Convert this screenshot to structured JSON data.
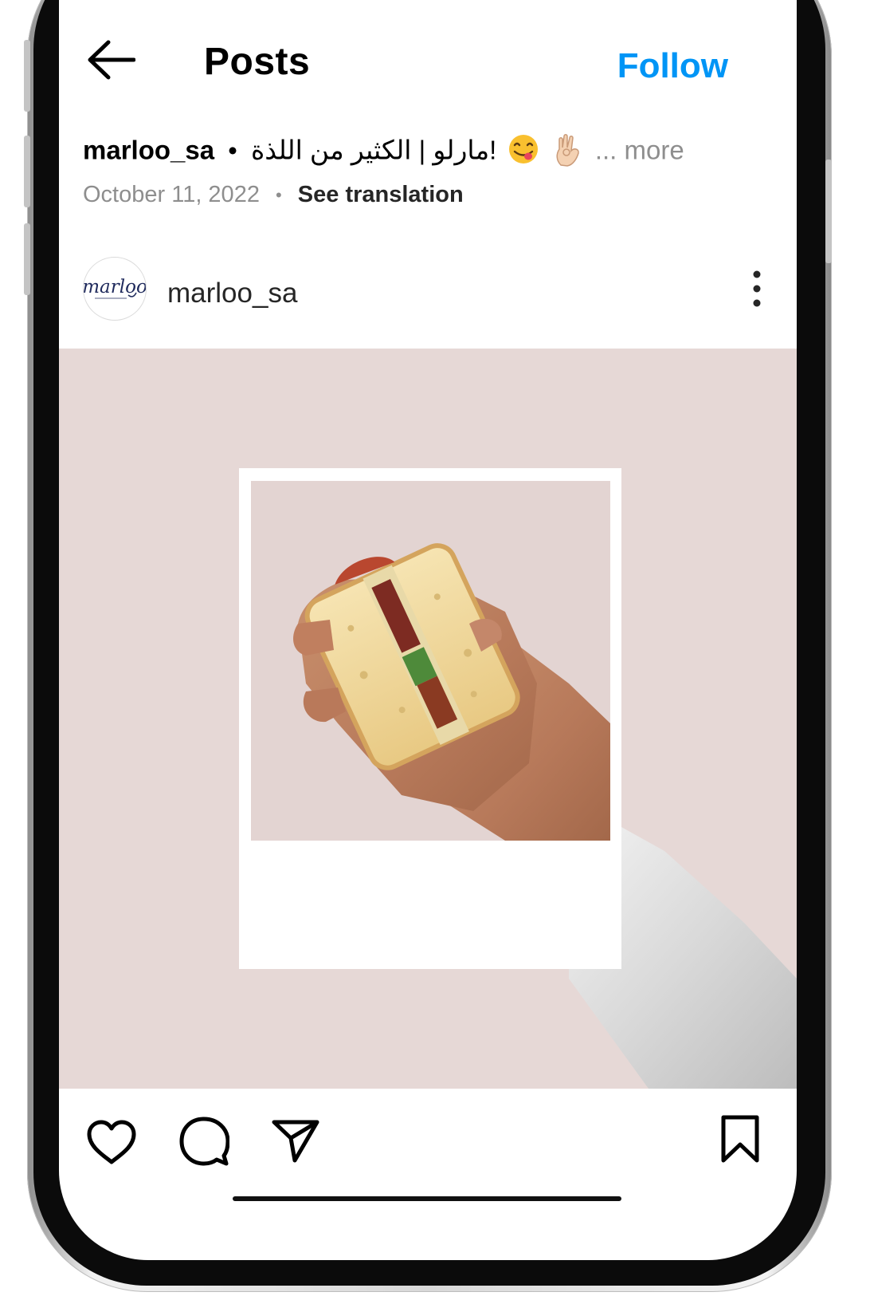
{
  "header": {
    "title": "Posts",
    "follow_label": "Follow",
    "back_icon": "back-arrow-icon"
  },
  "caption": {
    "username": "marloo_sa",
    "separator": "•",
    "text": "مارلو | الكثير من اللذة!",
    "emojis": [
      "face-savoring-food-emoji",
      "ok-hand-emoji"
    ],
    "ellipsis": "...",
    "more_label": "more"
  },
  "meta": {
    "date": "October 11, 2022",
    "dot": "•",
    "see_translation": "See translation"
  },
  "post": {
    "username": "marloo_sa",
    "avatar_logo_text": "marloo",
    "more_icon": "more-vertical-icon",
    "image_description_colors": {
      "background": "#e6d8d6",
      "polaroid_frame": "#ffffff"
    }
  },
  "actions": {
    "like_icon": "heart-icon",
    "comment_icon": "comment-icon",
    "share_icon": "send-icon",
    "save_icon": "bookmark-icon"
  },
  "colors": {
    "accent": "#0095f6",
    "secondary_text": "#8e8e8e",
    "primary_text": "#000000"
  }
}
